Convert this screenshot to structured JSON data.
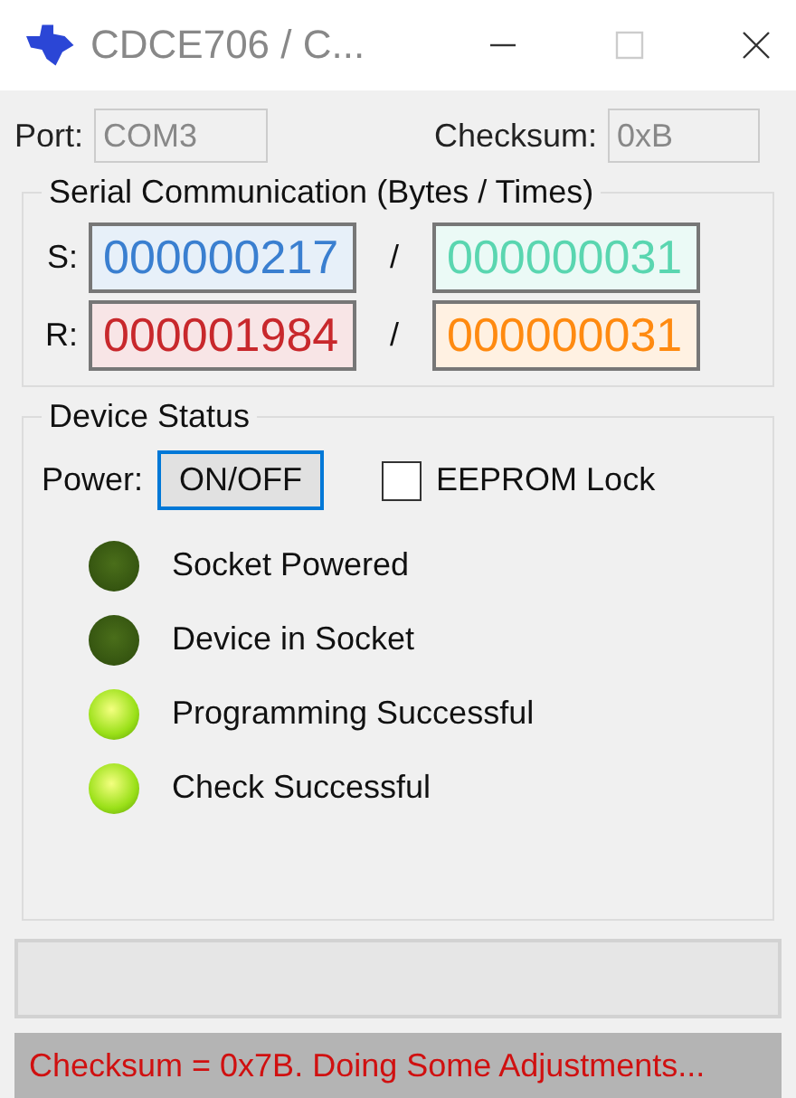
{
  "window": {
    "title": "CDCE706 / C..."
  },
  "port": {
    "label": "Port:",
    "value": "COM3"
  },
  "checksum": {
    "label": "Checksum:",
    "value": "0xB"
  },
  "serial": {
    "title": "Serial Communication (Bytes / Times)",
    "rows": [
      {
        "label": "S:",
        "separator": "/",
        "bytes": {
          "value": "000000217",
          "color": "#3a7fd0"
        },
        "times": {
          "value": "000000031",
          "color": "#5ad6b0"
        }
      },
      {
        "label": "R:",
        "separator": "/",
        "bytes": {
          "value": "000001984",
          "color": "#c8282c"
        },
        "times": {
          "value": "000000031",
          "color": "#ff8a10"
        }
      }
    ]
  },
  "device_status": {
    "title": "Device Status",
    "power_label": "Power:",
    "power_button": "ON/OFF",
    "eeprom_lock": {
      "label": "EEPROM Lock",
      "checked": false
    },
    "indicators": [
      {
        "label": "Socket Powered",
        "on": false
      },
      {
        "label": "Device in Socket",
        "on": false
      },
      {
        "label": "Programming Successful",
        "on": true
      },
      {
        "label": "Check Successful",
        "on": true
      }
    ]
  },
  "progress": {
    "level": 0
  },
  "status_bar": {
    "text": "Checksum = 0x7B. Doing Some Adjustments..."
  }
}
